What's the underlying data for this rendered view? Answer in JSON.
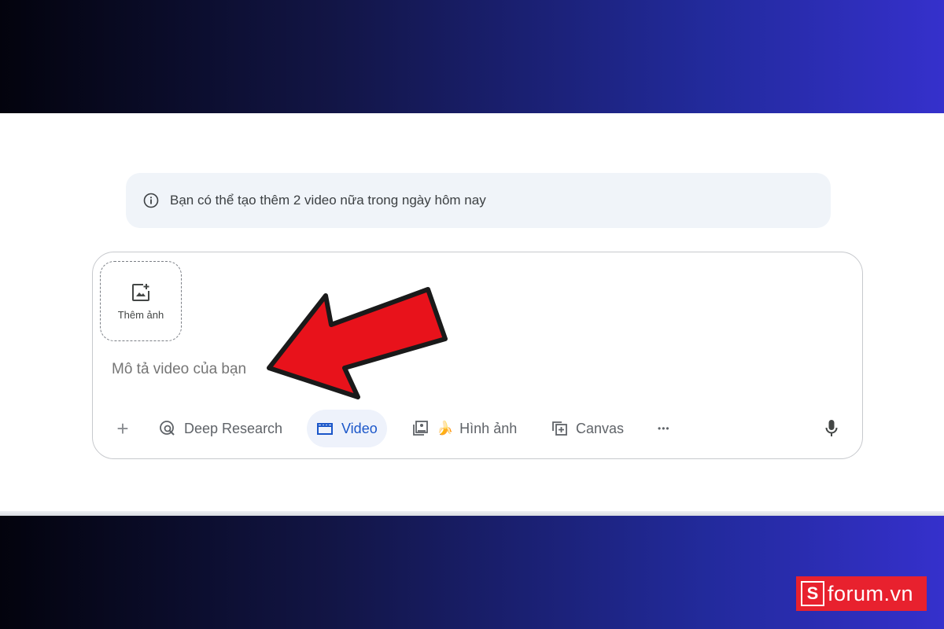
{
  "notice": {
    "icon": "info-icon",
    "text": "Bạn có thể tạo thêm 2 video nữa trong ngày hôm nay"
  },
  "composer": {
    "add_image_icon": "add-image-icon",
    "add_image_label": "Thêm ảnh",
    "prompt_placeholder": "Mô tả video của bạn"
  },
  "toolbar": {
    "plus_label": "+",
    "deep_research": {
      "icon": "deep-research-icon",
      "label": "Deep Research"
    },
    "video": {
      "icon": "video-icon",
      "label": "Video",
      "active": true
    },
    "image": {
      "icon": "image-gallery-icon",
      "emoji": "🍌",
      "label": "Hình ảnh"
    },
    "canvas": {
      "icon": "canvas-icon",
      "label": "Canvas"
    },
    "more_label": "•••",
    "mic_icon": "microphone-icon"
  },
  "watermark": {
    "text": "forum.vn",
    "mark": "S"
  },
  "colors": {
    "accent_blue": "#1a56c9",
    "arrow_red": "#e8121b",
    "watermark_red": "#e8212e"
  }
}
